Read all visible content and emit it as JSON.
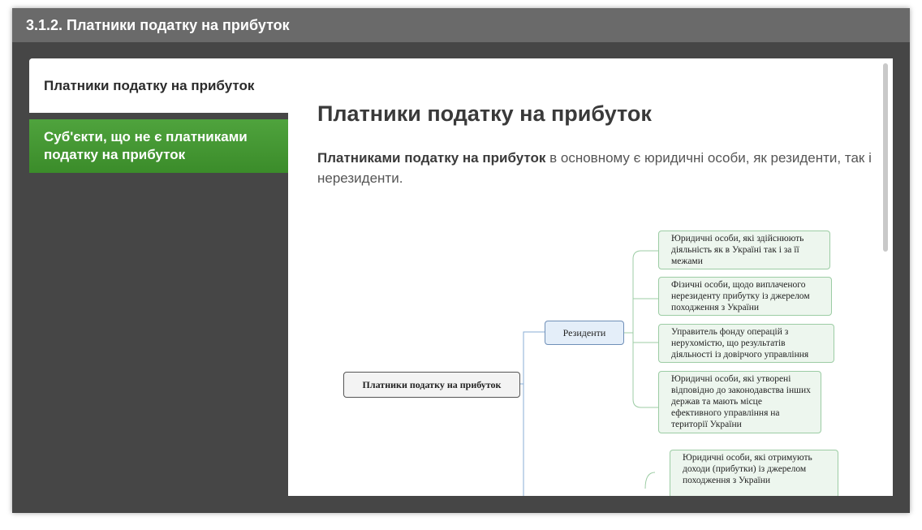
{
  "header": {
    "title": "3.1.2. Платники податку на прибуток"
  },
  "tabs": [
    {
      "label": "Платники податку на прибуток",
      "active": true
    },
    {
      "label": "Суб'єкти, що не є платниками податку на прибуток",
      "active": false
    }
  ],
  "main": {
    "heading": "Платники податку на прибуток",
    "intro_bold": "Платниками податку на прибуток",
    "intro_rest": " в основному є юридичні особи, як резиденти, так і нерезиденти."
  },
  "mindmap": {
    "root": "Платники податку на прибуток",
    "branch": "Резиденти",
    "leaves": [
      "Юридичні особи, які здійснюють діяльність як в Україні так і за її межами",
      "Фізичні особи, щодо виплаченого нерезиденту прибутку із джерелом походження з України",
      "Управитель фонду операцій з нерухомістю, що результатів діяльності із довірчого управління",
      "Юридичні особи, які утворені відповідно до законодавства інших держав та мають місце ефективного управління на території України",
      "Юридичні особи, які отримують доходи (прибутки) із джерелом походження з України"
    ]
  },
  "colors": {
    "titlebar": "#6a6a6a",
    "window_bg": "#464646",
    "active_tab": "#ffffff",
    "green_tab": "#45992f",
    "leaf_border": "#9ccca4",
    "branch_border": "#6f8fb8"
  }
}
